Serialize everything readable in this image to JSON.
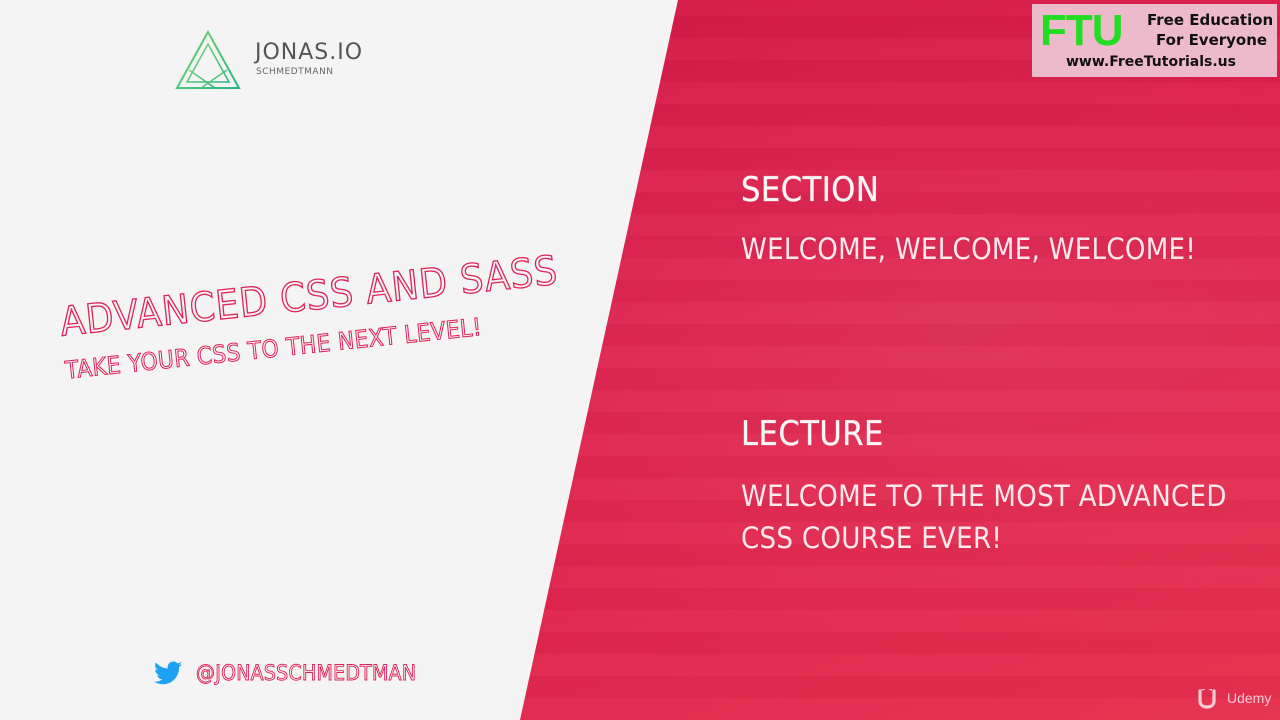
{
  "logo": {
    "title": "JONAS.IO",
    "subtitle": "SCHMEDTMANN",
    "mark_icon": "triangle-logo-icon"
  },
  "course": {
    "title": "Advanced CSS and Sass",
    "subtitle": "Take your CSS to the next level!"
  },
  "twitter": {
    "icon": "twitter-bird-icon",
    "handle": "@JONASSCHMEDTMAN"
  },
  "section": {
    "heading": "SECTION",
    "title": "WELCOME, WELCOME, WELCOME!"
  },
  "lecture": {
    "heading": "LECTURE",
    "title": "WELCOME TO THE MOST ADVANCED CSS COURSE EVER!"
  },
  "watermark": {
    "ftu_logo": "FTU",
    "line1": "Free Education",
    "line2": "For Everyone",
    "url": "www.FreeTutorials.us"
  },
  "udemy": {
    "icon": "udemy-u-icon",
    "label": "Udemy"
  },
  "colors": {
    "accent_pink": "#e0245a",
    "panel_pink": "#dc1d4a",
    "background": "#f4f4f4",
    "logo_green": "#55c57a",
    "twitter_blue": "#1da1f2",
    "ftu_green": "#22dd22"
  }
}
